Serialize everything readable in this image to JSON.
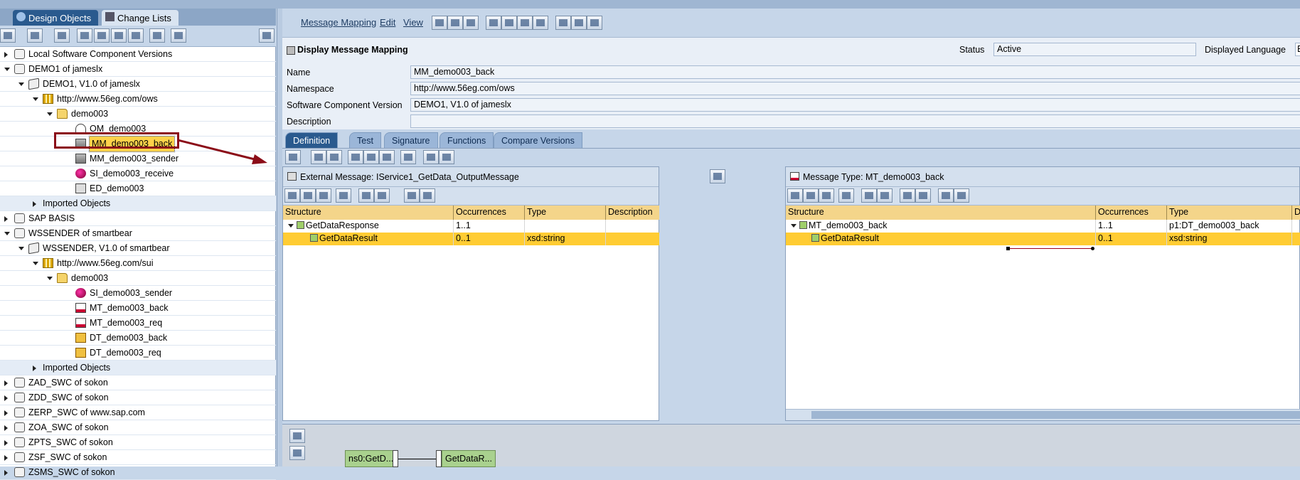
{
  "left_tabs": [
    {
      "label": "Design Objects"
    },
    {
      "label": "Change Lists"
    }
  ],
  "tree": [
    {
      "label": "Local Software Component Versions",
      "level": 0,
      "state": "closed",
      "icon": "swc-icon"
    },
    {
      "label": "DEMO1 of jameslx",
      "level": 0,
      "state": "open",
      "icon": "swc-icon"
    },
    {
      "label": "DEMO1, V1.0 of jameslx",
      "level": 1,
      "state": "open",
      "icon": "swcv-icon"
    },
    {
      "label": "http://www.56eg.com/ows",
      "level": 2,
      "state": "open",
      "icon": "namespace-icon"
    },
    {
      "label": "demo003",
      "level": 3,
      "state": "open",
      "icon": "folder-icon"
    },
    {
      "label": "OM_demo003",
      "level": 4,
      "state": "none",
      "icon": "operation-mapping-icon"
    },
    {
      "label": "MM_demo003_back",
      "level": 4,
      "state": "none",
      "icon": "message-mapping-icon",
      "selected": true
    },
    {
      "label": "MM_demo003_sender",
      "level": 4,
      "state": "none",
      "icon": "message-mapping-icon"
    },
    {
      "label": "SI_demo003_receive",
      "level": 4,
      "state": "none",
      "icon": "service-interface-icon"
    },
    {
      "label": "ED_demo003",
      "level": 4,
      "state": "none",
      "icon": "external-definition-icon"
    },
    {
      "label": "Imported Objects",
      "level": 2,
      "state": "closed",
      "icon": "",
      "alt": true
    },
    {
      "label": "SAP BASIS",
      "level": 0,
      "state": "closed",
      "icon": "swc-icon"
    },
    {
      "label": "WSSENDER of smartbear",
      "level": 0,
      "state": "open",
      "icon": "swc-icon"
    },
    {
      "label": "WSSENDER, V1.0 of smartbear",
      "level": 1,
      "state": "open",
      "icon": "swcv-icon"
    },
    {
      "label": "http://www.56eg.com/sui",
      "level": 2,
      "state": "open",
      "icon": "namespace-icon"
    },
    {
      "label": "demo003",
      "level": 3,
      "state": "open",
      "icon": "folder-icon"
    },
    {
      "label": "SI_demo003_sender",
      "level": 4,
      "state": "none",
      "icon": "service-interface-icon"
    },
    {
      "label": "MT_demo003_back",
      "level": 4,
      "state": "none",
      "icon": "message-type-icon"
    },
    {
      "label": "MT_demo003_req",
      "level": 4,
      "state": "none",
      "icon": "message-type-icon"
    },
    {
      "label": "DT_demo003_back",
      "level": 4,
      "state": "none",
      "icon": "data-type-icon"
    },
    {
      "label": "DT_demo003_req",
      "level": 4,
      "state": "none",
      "icon": "data-type-icon"
    },
    {
      "label": "Imported Objects",
      "level": 2,
      "state": "closed",
      "icon": "",
      "alt": true
    },
    {
      "label": "ZAD_SWC of sokon",
      "level": 0,
      "state": "closed",
      "icon": "swc-icon"
    },
    {
      "label": "ZDD_SWC of sokon",
      "level": 0,
      "state": "closed",
      "icon": "swc-icon"
    },
    {
      "label": "ZERP_SWC of www.sap.com",
      "level": 0,
      "state": "closed",
      "icon": "swc-icon"
    },
    {
      "label": "ZOA_SWC of sokon",
      "level": 0,
      "state": "closed",
      "icon": "swc-icon"
    },
    {
      "label": "ZPTS_SWC of sokon",
      "level": 0,
      "state": "closed",
      "icon": "swc-icon"
    },
    {
      "label": "ZSF_SWC of sokon",
      "level": 0,
      "state": "closed",
      "icon": "swc-icon"
    },
    {
      "label": "ZSMS_SWC of sokon",
      "level": 0,
      "state": "closed",
      "icon": "swc-icon"
    }
  ],
  "menus": [
    "Message Mapping",
    "Edit",
    "View"
  ],
  "header": {
    "title": "Display Message Mapping",
    "status_label": "Status",
    "status_value": "Active",
    "lang_label": "Displayed Language",
    "lang_value": "E",
    "fields": [
      {
        "label": "Name",
        "value": "MM_demo003_back"
      },
      {
        "label": "Namespace",
        "value": "http://www.56eg.com/ows"
      },
      {
        "label": "Software Component Version",
        "value": "DEMO1, V1.0 of jameslx"
      },
      {
        "label": "Description",
        "value": ""
      }
    ]
  },
  "tabs": [
    {
      "label": "Definition",
      "active": true
    },
    {
      "label": "Test"
    },
    {
      "label": "Signature"
    },
    {
      "label": "Functions"
    },
    {
      "label": "Compare Versions"
    }
  ],
  "source": {
    "title": "External Message: IService1_GetData_OutputMessage",
    "columns": [
      "Structure",
      "Occurrences",
      "Type",
      "Description"
    ],
    "rows": [
      {
        "structure": "GetDataResponse",
        "occ": "1..1",
        "type": "",
        "desc": "",
        "indent": 0,
        "expand": true
      },
      {
        "structure": "GetDataResult",
        "occ": "0..1",
        "type": "xsd:string",
        "desc": "",
        "indent": 1,
        "selected": true
      }
    ]
  },
  "target": {
    "title": "Message Type: MT_demo003_back",
    "columns": [
      "Structure",
      "Occurrences",
      "Type",
      "D"
    ],
    "rows": [
      {
        "structure": "MT_demo003_back",
        "occ": "1..1",
        "type": "p1:DT_demo003_back",
        "indent": 0,
        "expand": true
      },
      {
        "structure": "GetDataResult",
        "occ": "0..1",
        "type": "xsd:string",
        "indent": 1,
        "selected": true
      }
    ]
  },
  "editor": {
    "source_box": "ns0:GetD...",
    "target_box": "GetDataR..."
  }
}
